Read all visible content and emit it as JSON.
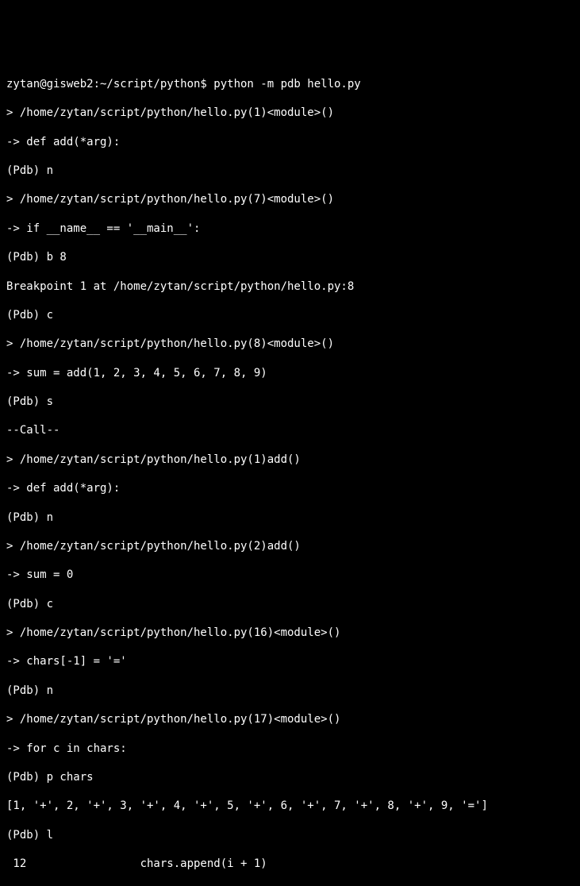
{
  "pdb_session": {
    "lines": [
      "zytan@gisweb2:~/script/python$ python -m pdb hello.py",
      "> /home/zytan/script/python/hello.py(1)<module>()",
      "-> def add(*arg):",
      "(Pdb) n",
      "> /home/zytan/script/python/hello.py(7)<module>()",
      "-> if __name__ == '__main__':",
      "(Pdb) b 8",
      "Breakpoint 1 at /home/zytan/script/python/hello.py:8",
      "(Pdb) c",
      "> /home/zytan/script/python/hello.py(8)<module>()",
      "-> sum = add(1, 2, 3, 4, 5, 6, 7, 8, 9)",
      "(Pdb) s",
      "--Call--",
      "> /home/zytan/script/python/hello.py(1)add()",
      "-> def add(*arg):",
      "(Pdb) n",
      "> /home/zytan/script/python/hello.py(2)add()",
      "-> sum = 0",
      "(Pdb) c",
      "> /home/zytan/script/python/hello.py(16)<module>()",
      "-> chars[-1] = '='",
      "(Pdb) n",
      "> /home/zytan/script/python/hello.py(17)<module>()",
      "-> for c in chars:",
      "(Pdb) p chars",
      "[1, '+', 2, '+', 3, '+', 4, '+', 5, '+', 6, '+', 7, '+', 8, '+', 9, '=']",
      "(Pdb) l",
      " 12                 chars.append(i + 1)"
    ]
  }
}
